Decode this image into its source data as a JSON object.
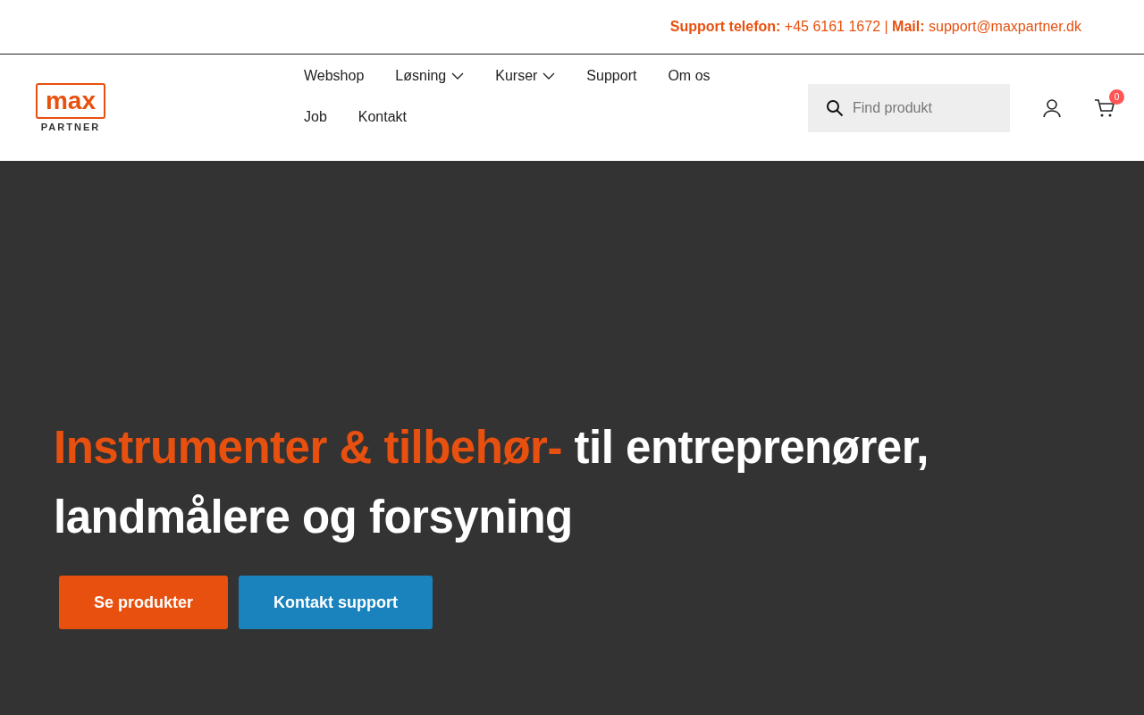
{
  "top_bar": {
    "contact": "**Support telefon:** +45 6161 1672 | **Mail:** support@maxpartner.dk"
  },
  "logo": {
    "word": "max",
    "tagline": "PARTNER"
  },
  "nav": [
    {
      "label": "Webshop",
      "dropdown": false
    },
    {
      "label": "Løsning",
      "dropdown": true
    },
    {
      "label": "Kurser",
      "dropdown": true
    },
    {
      "label": "Support",
      "dropdown": false
    },
    {
      "label": "Om os",
      "dropdown": false
    },
    {
      "label": "Job",
      "dropdown": false
    },
    {
      "label": "Kontakt",
      "dropdown": false
    }
  ],
  "search": {
    "placeholder": "Find produkt"
  },
  "cart": {
    "count": "0"
  },
  "hero": {
    "highlight": "Instrumenter & tilbehør-",
    "rest": " til entreprenører, landmålere og forsyning",
    "buttons": [
      {
        "label": "Se produkter",
        "kind": "primary"
      },
      {
        "label": "Kontakt support",
        "kind": "secondary"
      }
    ]
  }
}
